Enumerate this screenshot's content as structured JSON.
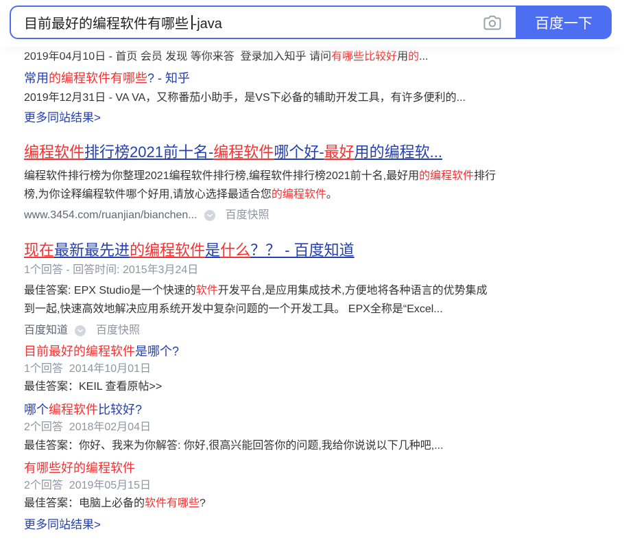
{
  "search": {
    "query": "目前最好的编程软件有哪些 -java",
    "button_label": "百度一下",
    "camera_icon": "camera-icon"
  },
  "colors": {
    "accent": "#4e6ef2",
    "link": "#2440b3",
    "highlight": "#f73131",
    "text": "#333333",
    "meta": "#9195a3",
    "source": "#626675"
  },
  "zhihu_result": {
    "snippet": [
      {
        "t": "2019年04月10日 - 首页 会员 发现 等你来答  登录加入知乎 请问"
      },
      {
        "t": "有哪些比较好",
        "hl": true
      },
      {
        "t": "用"
      },
      {
        "t": "的",
        "hl": true
      },
      {
        "t": "..."
      }
    ],
    "related_title": [
      {
        "t": "常用"
      },
      {
        "t": "的编程软件有哪些",
        "hl": true
      },
      {
        "t": "? - 知乎"
      }
    ],
    "related_snippet": "2019年12月31日 - VA VA，又称番茄小助手，是VS下必备的辅助开发工具，有许多便利的...",
    "more_label": "更多同站结果>"
  },
  "ranking_result": {
    "title": [
      {
        "t": "编程软件",
        "hl": true
      },
      {
        "t": "排行榜2021前十名-"
      },
      {
        "t": "编程软件",
        "hl": true
      },
      {
        "t": "哪个好-"
      },
      {
        "t": "最好",
        "hl": true
      },
      {
        "t": "用的编程软..."
      }
    ],
    "snippet_lines": [
      [
        {
          "t": "编程软件排行榜为你整理2021编程软件排行榜,编程软件排行榜2021前十名,最好用"
        },
        {
          "t": "的编程软件",
          "hl": true
        },
        {
          "t": "排行"
        }
      ],
      [
        {
          "t": "榜,为你诠释编程软件哪个好用,请放心选择最适合您"
        },
        {
          "t": "的编程软件",
          "hl": true
        },
        {
          "t": "。"
        }
      ]
    ],
    "url": "www.3454.com/ruanjian/bianchen...",
    "snapshot_icon": "chevron-down-circle-icon",
    "snapshot_label": "百度快照"
  },
  "zhidao_result": {
    "title": [
      {
        "t": "现在",
        "hl": true
      },
      {
        "t": "最新最先进"
      },
      {
        "t": "的编程软件",
        "hl": true
      },
      {
        "t": "是"
      },
      {
        "t": "什么",
        "hl": true
      },
      {
        "t": "？？ - 百度知道"
      }
    ],
    "meta": "1个回答 - 回答时间: 2015年3月24日",
    "snippet_lines": [
      [
        {
          "t": "最佳答案: EPX Studio是一个快速的"
        },
        {
          "t": "软件",
          "hl": true
        },
        {
          "t": "开发平台,是应用集成技术,方便地将各种语言的优势集成"
        }
      ],
      [
        {
          "t": "到一起,快速高效地解决应用系统开发中复杂问题的一个开发工具。 EPX全称是“Excel..."
        }
      ]
    ],
    "source": "百度知道",
    "snapshot_icon": "chevron-down-circle-icon",
    "snapshot_label": "百度快照",
    "related": [
      {
        "title": [
          {
            "t": "目前最好的编程软件",
            "hl": true
          },
          {
            "t": "是哪个?"
          }
        ],
        "meta": "1个回答  2014年10月01日",
        "answer": [
          {
            "t": "最佳答案：KEIL 查看原帖>>"
          }
        ]
      },
      {
        "title": [
          {
            "t": "哪个"
          },
          {
            "t": "编程软件",
            "hl": true
          },
          {
            "t": "比较好?"
          }
        ],
        "meta": "2个回答  2018年02月04日",
        "answer": [
          {
            "t": "最佳答案：你好、我来为你解答: 你好,很高兴能回答你的问题,我给你说说以下几种吧,..."
          }
        ]
      },
      {
        "title": [
          {
            "t": "有哪些好的编程软件",
            "hl": true
          }
        ],
        "meta": "2个回答  2019年05月15日",
        "answer": [
          {
            "t": "最佳答案：电脑上必备的"
          },
          {
            "t": "软件有哪些",
            "hl": true
          },
          {
            "t": "?"
          }
        ]
      }
    ],
    "more_label": "更多同站结果>"
  }
}
